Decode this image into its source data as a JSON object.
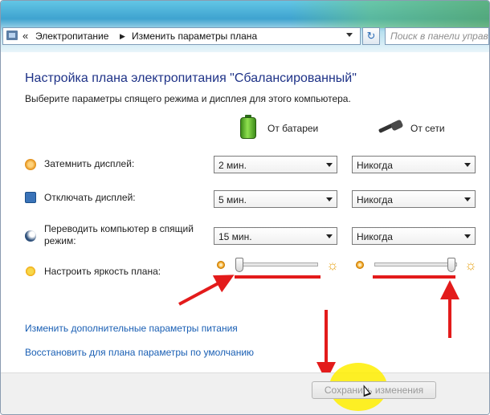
{
  "address_bar": {
    "sep1": "«",
    "crumb1": "Электропитание",
    "sep2": "▶",
    "crumb2": "Изменить параметры плана"
  },
  "refresh_symbol": "↻",
  "search": {
    "placeholder": "Поиск в панели управ"
  },
  "main": {
    "title": "Настройка плана электропитания \"Сбалансированный\"",
    "subtitle": "Выберите параметры спящего режима и дисплея для этого компьютера.",
    "columns": {
      "battery": "От батареи",
      "ac": "От сети"
    },
    "rows": [
      {
        "label": "Затемнить дисплей:",
        "icon": "dim-display-icon",
        "battery": "2 мин.",
        "ac": "Никогда"
      },
      {
        "label": "Отключать дисплей:",
        "icon": "monitor-icon",
        "battery": "5 мин.",
        "ac": "Никогда"
      },
      {
        "label_line1": "Переводить компьютер в спящий",
        "label_line2": "режим:",
        "icon": "sleep-icon",
        "battery": "15 мин.",
        "ac": "Никогда"
      }
    ],
    "brightness": {
      "label": "Настроить яркость плана:",
      "battery_level": 0.0,
      "ac_level": 1.0
    },
    "links": {
      "advanced": "Изменить дополнительные параметры питания",
      "restore": "Восстановить для плана параметры по умолчанию"
    },
    "save_button": "Сохранить изменения"
  },
  "colors": {
    "heading": "#1e3287",
    "link": "#1a5fb4",
    "annotation_red": "#e31b1b",
    "highlight_yellow": "#ffee00"
  }
}
